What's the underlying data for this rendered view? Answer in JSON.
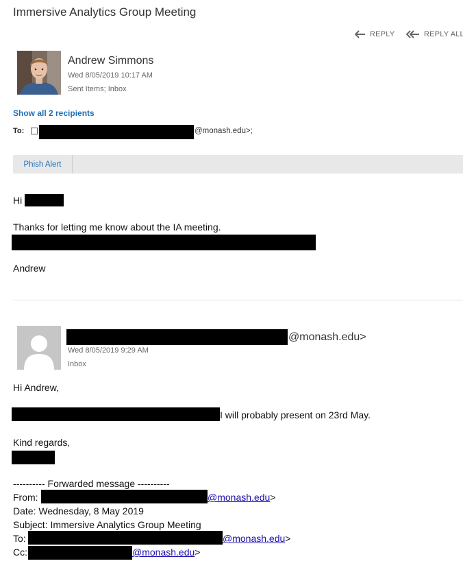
{
  "email": {
    "subject": "Immersive Analytics Group Meeting",
    "reply_label": "REPLY",
    "reply_all_label": "REPLY ALL"
  },
  "message1": {
    "sender_name": "Andrew Simmons",
    "date": "Wed 8/05/2019 10:17 AM",
    "folders": "Sent Items; Inbox",
    "show_recipients": "Show all 2 recipients",
    "to_label": "To:",
    "to_suffix": "@monash.edu>;",
    "phish_alert": "Phish Alert",
    "greeting": "Hi",
    "line1": "Thanks for letting me know about the IA meeting.",
    "signoff": "Andrew"
  },
  "message2": {
    "sender_suffix": "@monash.edu>",
    "date": "Wed 8/05/2019 9:29 AM",
    "folders": "Inbox",
    "greeting": "Hi Andrew,",
    "line1_suffix": " I will probably present on 23rd May.",
    "regards": "Kind regards,",
    "fwd_header": "---------- Forwarded message ----------",
    "from_label": "From:",
    "from_email": "@monash.edu",
    "date_line": "Date: Wednesday, 8 May 2019",
    "subject_line": "Subject: Immersive Analytics Group Meeting",
    "to_label": "To:",
    "to_email": "@monash.edu",
    "cc_label": "Cc:",
    "cc_email": "@monash.edu",
    "close_bracket": ">"
  },
  "colors": {
    "link": "#1f6fb5",
    "toolbar": "#e8e8e8",
    "redaction": "#000000"
  }
}
